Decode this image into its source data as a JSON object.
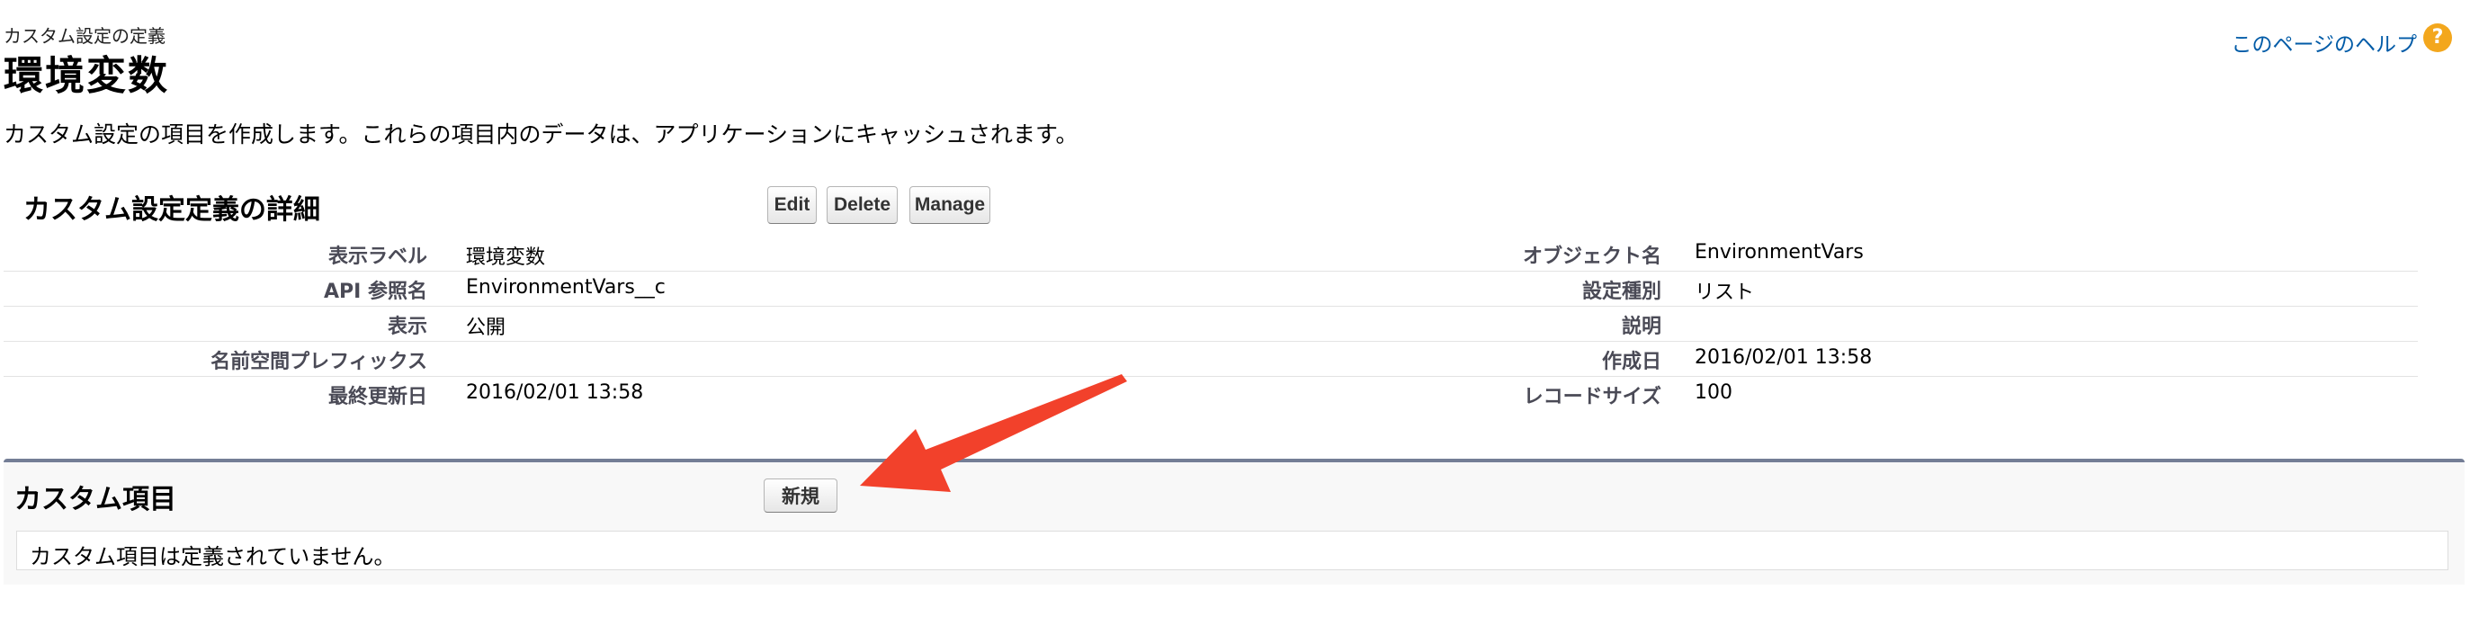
{
  "header": {
    "subtitle": "カスタム設定の定義",
    "title": "環境変数",
    "help_link": "このページのヘルプ",
    "help_icon": "?"
  },
  "description": "カスタム設定の項目を作成します。これらの項目内のデータは、アプリケーションにキャッシュされます。",
  "detail": {
    "heading": "カスタム設定定義の詳細",
    "buttons": {
      "edit": "Edit",
      "delete": "Delete",
      "manage": "Manage"
    },
    "rows": [
      {
        "left_label": "表示ラベル",
        "left_value": "環境変数",
        "right_label": "オブジェクト名",
        "right_value": "EnvironmentVars"
      },
      {
        "left_label": "API 参照名",
        "left_value": "EnvironmentVars__c",
        "right_label": "設定種別",
        "right_value": "リスト"
      },
      {
        "left_label": "表示",
        "left_value": "公開",
        "right_label": "説明",
        "right_value": ""
      },
      {
        "left_label": "名前空間プレフィックス",
        "left_value": "",
        "right_label": "作成日",
        "right_value": "2016/02/01 13:58"
      },
      {
        "left_label": "最終更新日",
        "left_value": "2016/02/01 13:58",
        "right_label": "レコードサイズ",
        "right_value": "100"
      }
    ]
  },
  "custom_fields": {
    "heading": "カスタム項目",
    "new_button": "新規",
    "empty_message": "カスタム項目は定義されていません。"
  },
  "colors": {
    "link": "#015ba7",
    "help_icon": "#f3a71d",
    "panel_border": "#747e96",
    "annotation_arrow": "#f2412b"
  }
}
